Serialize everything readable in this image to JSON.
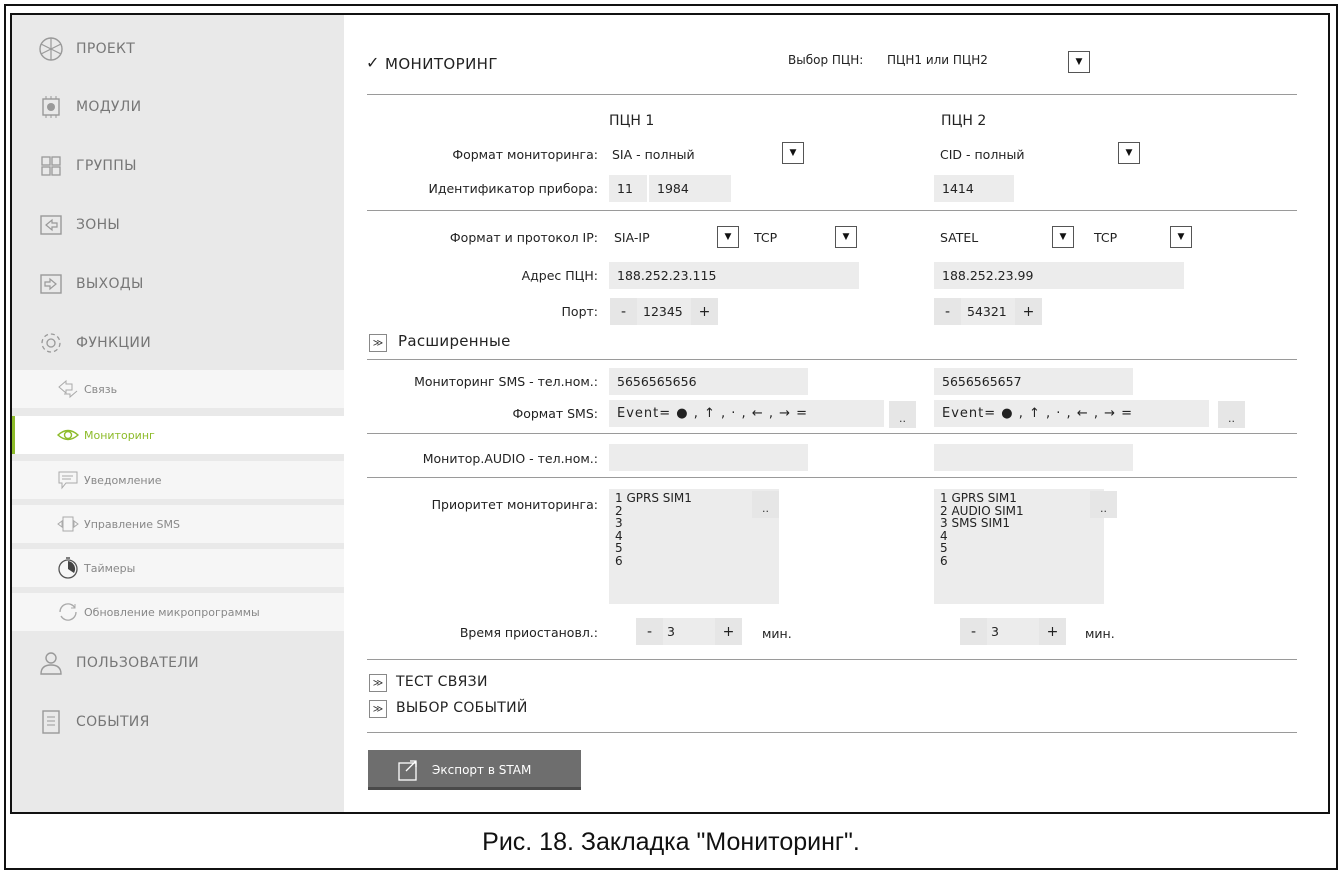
{
  "sidebar": {
    "items": [
      {
        "label": "ПРОЕКТ",
        "icon": "project-icon"
      },
      {
        "label": "МОДУЛИ",
        "icon": "module-icon"
      },
      {
        "label": "ГРУППЫ",
        "icon": "groups-icon"
      },
      {
        "label": "ЗОНЫ",
        "icon": "zones-icon"
      },
      {
        "label": "ВЫХОДЫ",
        "icon": "outputs-icon"
      },
      {
        "label": "ФУНКЦИИ",
        "icon": "gear-icon"
      }
    ],
    "subitems": [
      {
        "label": "Связь",
        "icon": "link-icon"
      },
      {
        "label": "Мониторинг",
        "icon": "eye-icon",
        "active": true
      },
      {
        "label": "Уведомление",
        "icon": "message-icon"
      },
      {
        "label": "Управление SMS",
        "icon": "sms-control-icon"
      },
      {
        "label": "Таймеры",
        "icon": "timer-icon"
      },
      {
        "label": "Обновление микропрограммы",
        "icon": "refresh-icon"
      }
    ],
    "bottom_items": [
      {
        "label": "ПОЛЬЗОВАТЕЛИ",
        "icon": "user-icon"
      },
      {
        "label": "СОБЫТИЯ",
        "icon": "events-icon"
      }
    ],
    "accent": "#8dbb2a"
  },
  "main": {
    "monitoring_check": "✓",
    "monitoring_title": "МОНИТОРИНГ",
    "select_label": "Выбор ПЦН:",
    "select_value": "ПЦН1 или ПЦН2",
    "col1": "ПЦН 1",
    "col2": "ПЦН 2",
    "format_label": "Формат мониторинга:",
    "format1": "SIA - полный",
    "format2": "CID - полный",
    "id_label": "Идентификатор прибора:",
    "id1a": "11",
    "id1b": "1984",
    "id2": "1414",
    "ip_label": "Формат и протокол IP:",
    "ip1": "SIA-IP",
    "proto1": "TCP",
    "ip2": "SATEL",
    "proto2": "TCP",
    "addr_label": "Адрес ПЦН:",
    "addr1": "188.252.23.115",
    "addr2": "188.252.23.99",
    "port_label": "Порт:",
    "port1": "12345",
    "port2": "54321",
    "minus": "-",
    "plus": "+",
    "advanced": "Расширенные",
    "sms_tel_label": "Мониторинг SMS - тел.ном.:",
    "sms_tel1": "5656565656",
    "sms_tel2": "5656565657",
    "sms_format_label": "Формат SMS:",
    "sms_format1": "Event= ● , ↑ , · , ← , → =",
    "sms_format2": "Event= ● , ↑ , · , ← , → =",
    "ellipsis": "..",
    "audio_label": "Монитор.AUDIO - тел.ном.:",
    "audio1": "",
    "audio2": "",
    "priority_label": "Приоритет мониторинга:",
    "priority1": [
      "1 GPRS SIM1",
      "2",
      "3",
      "4",
      "5",
      "6"
    ],
    "priority2": [
      "1 GPRS SIM1",
      "2 AUDIO SIM1",
      "3 SMS SIM1",
      "4",
      "5",
      "6"
    ],
    "pause_label": "Время приостановл.:",
    "pause1": "3",
    "pause2": "3",
    "minutes": "мин.",
    "test_link": "ТЕСТ СВЯЗИ",
    "event_select": "ВЫБОР СОБЫТИЙ",
    "export": "Экспорт в STAM"
  },
  "caption": "Рис. 18. Закладка \"Мониторинг\"."
}
